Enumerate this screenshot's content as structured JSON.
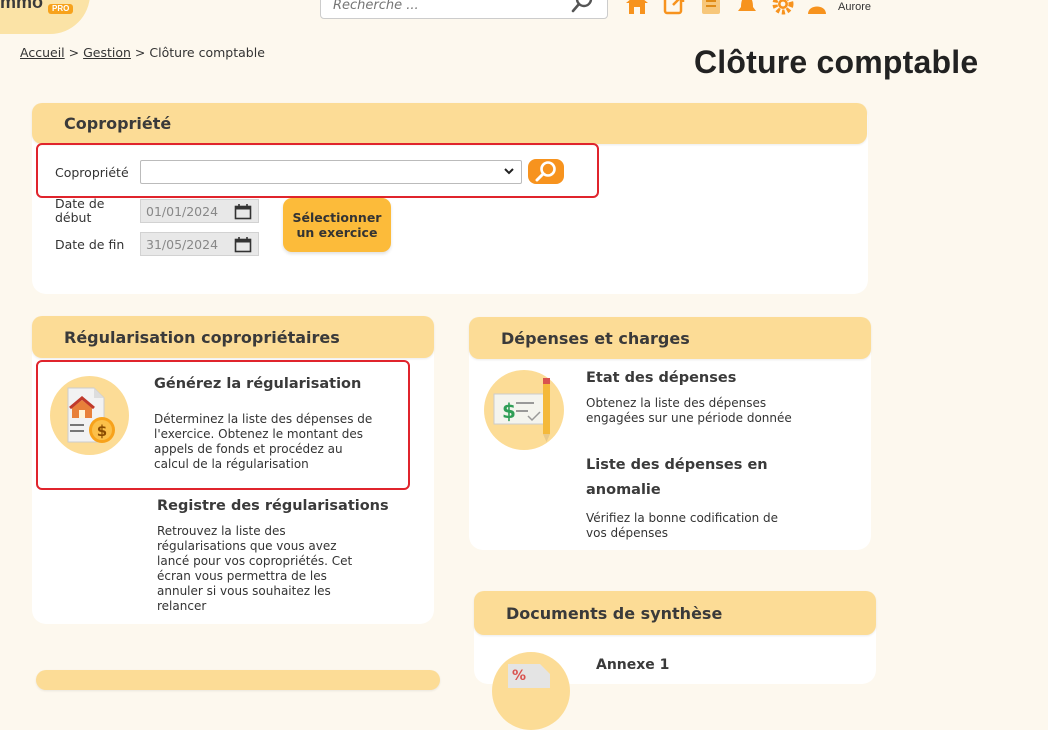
{
  "topbar": {
    "logo_text": "mmo",
    "logo_badge": "PRO",
    "search_placeholder": "Recherche ...",
    "user_name": "Aurore"
  },
  "breadcrumb": {
    "home": "Accueil",
    "sep1": ">",
    "section": "Gestion",
    "sep2": ">",
    "current": "Clôture comptable"
  },
  "page_title": "Clôture comptable",
  "copropriete_card": {
    "title": "Copropriété",
    "field_label": "Copropriété",
    "field_value": "",
    "start_label": "Date de début",
    "start_value": "01/01/2024",
    "end_label": "Date de fin",
    "end_value": "31/05/2024",
    "select_exercise_button": "Sélectionner un exercice"
  },
  "regularisation_card": {
    "title": "Régularisation copropriétaires",
    "items": [
      {
        "title": "Générez la régularisation",
        "desc": "Déterminez la liste des dépenses de l'exercice. Obtenez le montant des appels de fonds et procédez au calcul de la régularisation"
      },
      {
        "title": "Registre des régularisations",
        "desc": "Retrouvez la liste des régularisations que vous avez lancé pour vos copropriétés. Cet écran vous permettra de les annuler si vous souhaitez les relancer"
      }
    ]
  },
  "depenses_card": {
    "title": "Dépenses et charges",
    "items": [
      {
        "title": "Etat des dépenses",
        "desc": "Obtenez la liste des dépenses engagées sur une période donnée"
      },
      {
        "title": "Liste des dépenses en anomalie",
        "desc": "Vérifiez la bonne codification de vos dépenses"
      }
    ]
  },
  "documents_card": {
    "title": "Documents de synthèse",
    "items": [
      {
        "title": "Annexe 1"
      }
    ]
  },
  "colors": {
    "page_bg": "#fdf8ee",
    "header_yellow": "#fcdc96",
    "accent_orange": "#f7931e",
    "button_yellow": "#fcbb3a",
    "highlight_red": "#e0242c"
  }
}
